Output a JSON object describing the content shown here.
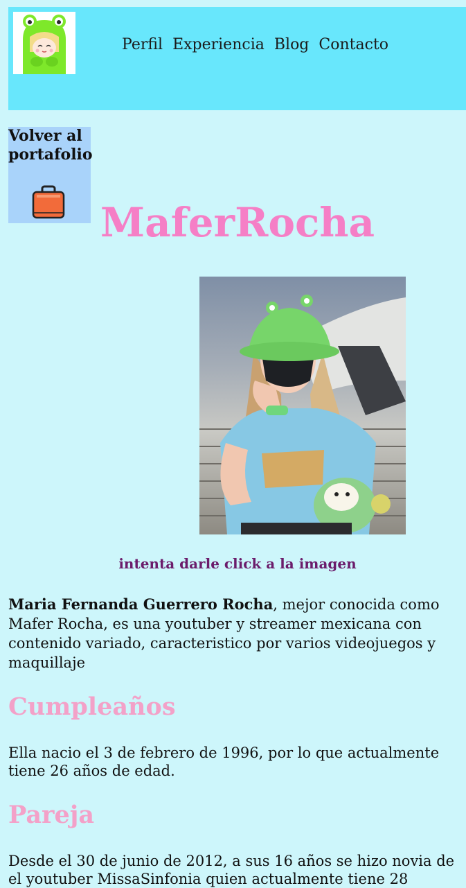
{
  "nav": {
    "items": [
      "Perfil",
      "Experiencia",
      "Blog",
      "Contacto"
    ]
  },
  "back": {
    "label": "Volver al portafolio"
  },
  "page": {
    "title": "MaferRocha",
    "photo_caption": "intenta darle click a la imagen"
  },
  "bio": {
    "name": "Maria Fernanda Guerrero Rocha",
    "text": ", mejor conocida como Mafer Rocha, es una youtuber y streamer mexicana con contenido variado, caracteristico por varios videojuegos y maquillaje"
  },
  "sections": [
    {
      "heading": "Cumpleaños",
      "text": "Ella nacio el 3 de febrero de 1996, por lo que actualmente tiene 26 años de edad."
    },
    {
      "heading": "Pareja",
      "text": "Desde el 30 de junio de 2012, a sus 16 años se hizo novia de el youtuber MissaSinfonia quien actualmente tiene 28"
    }
  ],
  "colors": {
    "page_bg": "#cdf6fb",
    "header_bg": "#68e7fc",
    "back_bg": "#a9d3fa",
    "title": "#f57fc6",
    "heading": "#f3a1c8",
    "caption": "#6b1c6b"
  },
  "icons": {
    "logo": "frog-hood-avatar",
    "back": "briefcase-icon"
  }
}
